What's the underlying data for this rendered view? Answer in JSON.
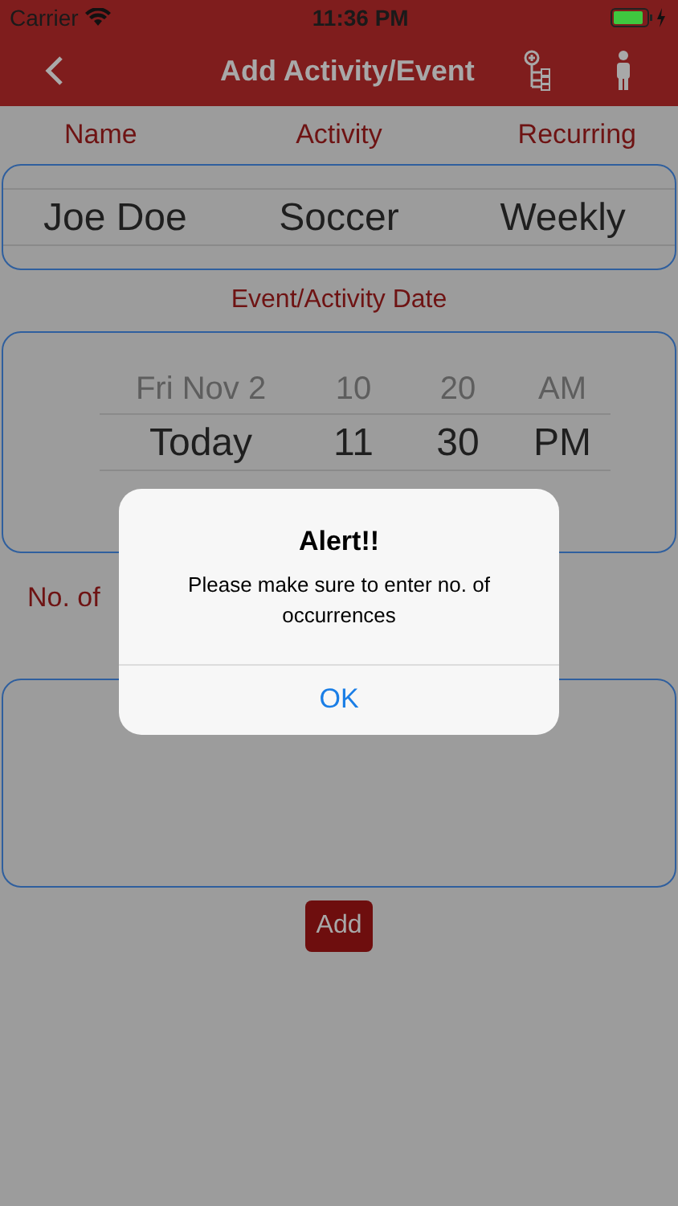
{
  "status_bar": {
    "carrier": "Carrier",
    "time": "11:36 PM"
  },
  "nav_bar": {
    "title": "Add Activity/Event"
  },
  "columns": [
    "Name",
    "Activity",
    "Recurring"
  ],
  "activity_picker": {
    "rows": [
      {
        "kind": "selected",
        "cells": [
          "Joe Doe",
          "Soccer",
          "Weekly"
        ]
      }
    ]
  },
  "date_label": "Event/Activity Date",
  "date_picker": {
    "rows": [
      {
        "kind": "faded",
        "cells": [
          "Fri Nov 2",
          "10",
          "20",
          "AM"
        ]
      },
      {
        "kind": "selected",
        "cells": [
          "Today",
          "11",
          "30",
          "PM"
        ]
      }
    ]
  },
  "occurrences_label": "No. of",
  "add_button": "Add",
  "alert": {
    "title": "Alert!!",
    "message": "Please make sure to enter no. of occurrences",
    "buttons": [
      "OK"
    ]
  }
}
